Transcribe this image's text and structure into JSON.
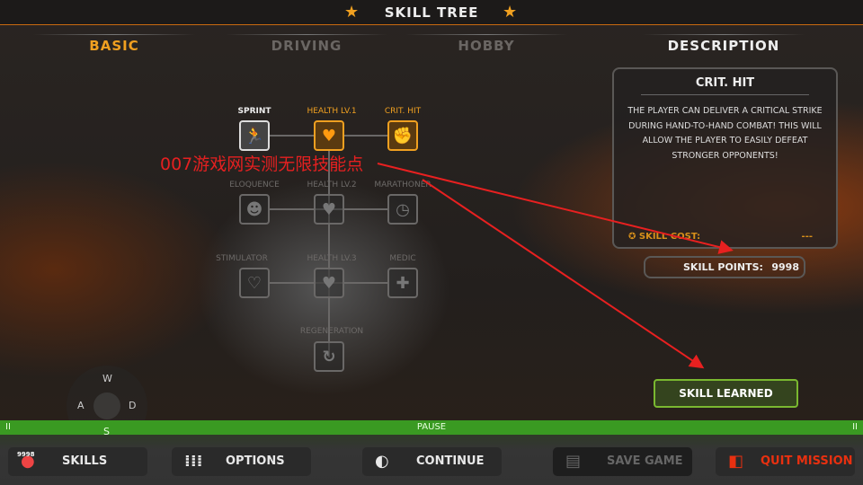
{
  "header": {
    "title": "SKILL TREE",
    "icon": "star-icon"
  },
  "tabs": [
    {
      "label": "BASIC",
      "active": true
    },
    {
      "label": "DRIVING"
    },
    {
      "label": "HOBBY"
    }
  ],
  "description_header": "DESCRIPTION",
  "skills": [
    {
      "label": "SPRINT",
      "state": "learned",
      "icon": "sprint-icon"
    },
    {
      "label": "HEALTH LV.1",
      "state": "learned",
      "icon": "heart-icon"
    },
    {
      "label": "CRIT. HIT",
      "state": "selected",
      "icon": "fist-icon"
    },
    {
      "label": "ELOQUENCE",
      "state": "locked",
      "icon": "speaking-head-icon"
    },
    {
      "label": "HEALTH LV.2",
      "state": "locked",
      "icon": "heart-icon"
    },
    {
      "label": "MARATHONER",
      "state": "locked",
      "icon": "stopwatch-icon"
    },
    {
      "label": "STIMULATOR",
      "state": "locked",
      "icon": "heart-plus-icon"
    },
    {
      "label": "HEALTH LV.3",
      "state": "locked",
      "icon": "heart-icon"
    },
    {
      "label": "MEDIC",
      "state": "locked",
      "icon": "medkit-icon"
    },
    {
      "label": "REGENERATION",
      "state": "locked",
      "icon": "regen-icon"
    }
  ],
  "detail": {
    "title": "CRIT. HIT",
    "text": "THE PLAYER CAN DELIVER A CRITICAL STRIKE DURING HAND-TO-HAND COMBAT! THIS WILL ALLOW THE PLAYER TO EASILY DEFEAT STRONGER OPPONENTS!",
    "cost_label": "SKILL COST:",
    "cost_value": "---"
  },
  "skill_points": {
    "label": "SKILL POINTS:",
    "value": "9998"
  },
  "learn_button": "SKILL LEARNED",
  "pause_label": "PAUSE",
  "joystick": {
    "up": "W",
    "left": "A",
    "right": "D",
    "down": "S"
  },
  "bottom": {
    "skills": "SKILLS",
    "skills_badge": "9998",
    "options": "OPTIONS",
    "continue": "CONTINUE",
    "save": "SAVE GAME",
    "quit": "QUIT MISSION"
  },
  "watermark": "007游戏网实测无限技能点",
  "colors": {
    "accent": "#f0a020",
    "pause_bar": "#3a9a22",
    "quit": "#e83010"
  }
}
